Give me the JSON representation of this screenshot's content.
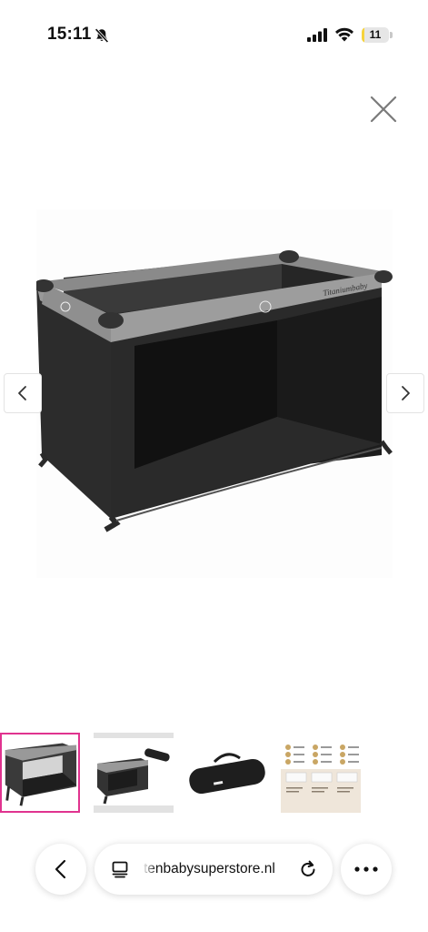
{
  "status_bar": {
    "time": "15:11",
    "battery_level": "11",
    "battery_fraction": 0.11,
    "icons": [
      "bell-slash-icon",
      "cellular-signal-icon",
      "wifi-icon",
      "battery-icon"
    ]
  },
  "viewer": {
    "close_icon": "close-icon",
    "prev_icon": "chevron-left-icon",
    "next_icon": "chevron-right-icon",
    "brand_text": "Titaniumbaby",
    "thumbnails": [
      {
        "name": "thumb-crib-front",
        "selected": true
      },
      {
        "name": "thumb-crib-with-bag",
        "selected": false
      },
      {
        "name": "thumb-carry-bag",
        "selected": false
      },
      {
        "name": "thumb-mattress-chart",
        "selected": false
      }
    ],
    "accent": "#e0338f"
  },
  "browser_bar": {
    "url": "tenbabysuperstore.nl",
    "icons": [
      "chevron-left-icon",
      "tab-icon",
      "reload-icon",
      "more-icon"
    ]
  }
}
